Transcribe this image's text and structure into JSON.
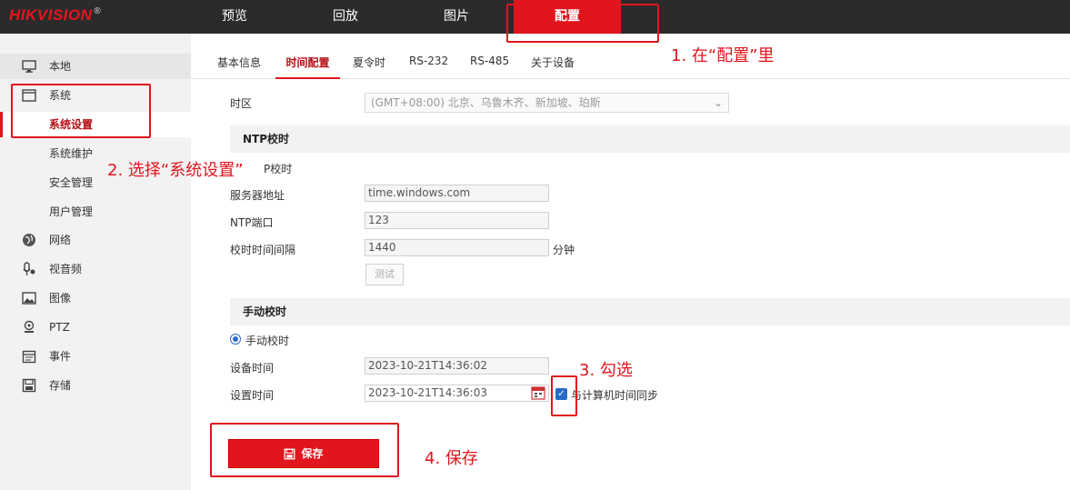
{
  "brand": {
    "name": "HIKVISION",
    "mark": "®"
  },
  "topnav": [
    {
      "label": "预览"
    },
    {
      "label": "回放"
    },
    {
      "label": "图片"
    },
    {
      "label": "配置"
    }
  ],
  "sidebar": {
    "items": [
      {
        "label": "本地",
        "icon": "monitor-icon"
      },
      {
        "label": "系统",
        "icon": "system-icon"
      },
      {
        "label": "系统设置"
      },
      {
        "label": "系统维护"
      },
      {
        "label": "安全管理"
      },
      {
        "label": "用户管理"
      },
      {
        "label": "网络",
        "icon": "globe-icon"
      },
      {
        "label": "视音频",
        "icon": "mic-icon"
      },
      {
        "label": "图像",
        "icon": "image-icon"
      },
      {
        "label": "PTZ",
        "icon": "ptz-icon"
      },
      {
        "label": "事件",
        "icon": "calendar-icon"
      },
      {
        "label": "存储",
        "icon": "storage-icon"
      }
    ]
  },
  "tabs": [
    {
      "label": "基本信息"
    },
    {
      "label": "时间配置"
    },
    {
      "label": "夏令时"
    },
    {
      "label": "RS-232"
    },
    {
      "label": "RS-485"
    },
    {
      "label": "关于设备"
    }
  ],
  "timezone": {
    "label": "时区",
    "value": "(GMT+08:00) 北京、乌鲁木齐、新加坡、珀斯"
  },
  "ntp": {
    "section_title": "NTP校时",
    "partial_label": "P校时",
    "server_label": "服务器地址",
    "server_value": "time.windows.com",
    "port_label": "NTP端口",
    "port_value": "123",
    "interval_label": "校时时间间隔",
    "interval_value": "1440",
    "interval_unit": "分钟",
    "test_label": "测试"
  },
  "manual": {
    "section_title": "手动校时",
    "radio_label": "手动校时",
    "device_time_label": "设备时间",
    "device_time_value": "2023-10-21T14:36:02",
    "set_time_label": "设置时间",
    "set_time_value": "2023-10-21T14:36:03",
    "sync_label": "与计算机时间同步"
  },
  "save_label": "保存",
  "annotations": {
    "step1": "1. 在“配置”里",
    "step2": "2. 选择“系统设置”",
    "step3": "3. 勾选",
    "step4": "4. 保存"
  },
  "colors": {
    "accent": "#e0151d",
    "topbar": "#2b2b2b",
    "sidebar": "#f2f2f2",
    "link": "#2a6ac9"
  }
}
